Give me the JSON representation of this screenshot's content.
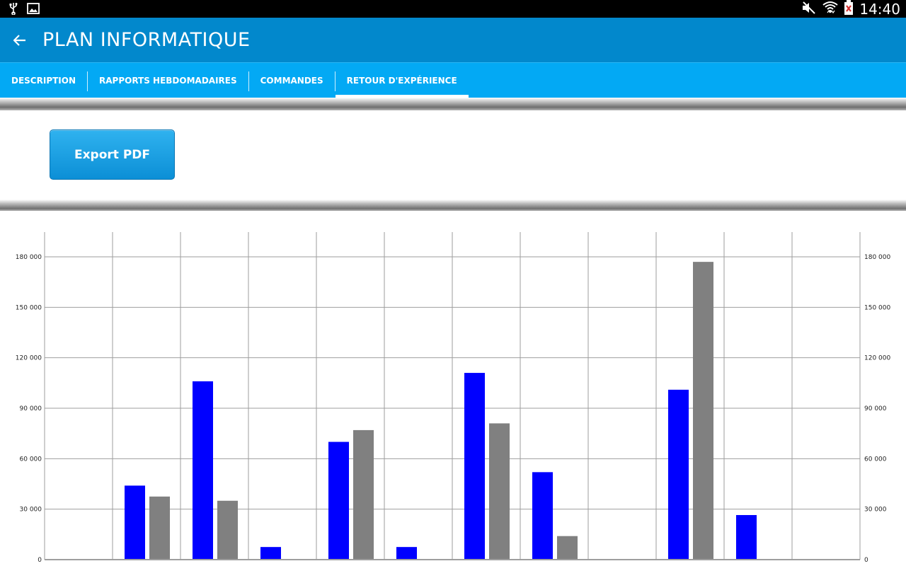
{
  "status_bar": {
    "time": "14:40",
    "icons_left": [
      "usb-icon",
      "image-icon"
    ],
    "icons_right": [
      "mute-icon",
      "wifi-icon",
      "battery-icon"
    ]
  },
  "action_bar": {
    "back_icon": "back-arrow-icon",
    "title": "PLAN INFORMATIQUE"
  },
  "tabs": [
    {
      "label": "DESCRIPTION",
      "active": false
    },
    {
      "label": "RAPPORTS HEBDOMADAIRES",
      "active": false
    },
    {
      "label": "COMMANDES",
      "active": false
    },
    {
      "label": "RETOUR D'EXPÉRIENCE",
      "active": true
    }
  ],
  "actions": {
    "export_label": "Export PDF"
  },
  "colors": {
    "action_bar": "#0288cc",
    "tab_bar": "#03a9f4",
    "series_1": "#0000ff",
    "series_2": "#808080"
  },
  "chart_data": {
    "type": "bar",
    "categories": [
      "",
      "",
      "",
      "",
      "",
      "",
      "",
      "",
      "",
      "",
      "",
      ""
    ],
    "series": [
      {
        "values": [
          0,
          44000,
          106000,
          7500,
          70000,
          7500,
          111000,
          52000,
          0,
          101000,
          26500,
          0
        ]
      },
      {
        "values": [
          0,
          37500,
          35000,
          0,
          77000,
          0,
          81000,
          14000,
          0,
          177000,
          0,
          0
        ]
      }
    ],
    "ylim": [
      0,
      195000
    ],
    "y_ticks": [
      0,
      30000,
      60000,
      90000,
      120000,
      150000,
      180000
    ],
    "y_tick_labels": [
      "0",
      "30 000",
      "60 000",
      "90 000",
      "120 000",
      "150 000",
      "180 000"
    ],
    "grid": true,
    "secondary_axis": true
  }
}
